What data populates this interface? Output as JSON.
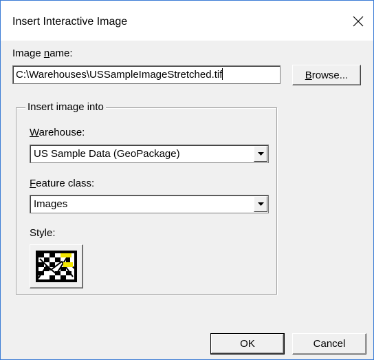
{
  "dialog": {
    "title": "Insert Interactive Image",
    "close_glyph": "✕"
  },
  "image_name": {
    "label_pre": "Image ",
    "label_accel": "n",
    "label_post": "ame:",
    "value": "C:\\Warehouses\\USSampleImageStretched.tif"
  },
  "browse_button": {
    "accel": "B",
    "rest": "rowse..."
  },
  "insert_group": {
    "legend": "Insert image into",
    "warehouse": {
      "label_accel": "W",
      "label_rest": "arehouse:",
      "selected": "US Sample Data (GeoPackage)"
    },
    "feature_class": {
      "label_accel": "F",
      "label_rest": "eature class:",
      "selected": "Images"
    },
    "style": {
      "label": "Style:",
      "icon": "image-style-icon",
      "colors": {
        "black": "#000000",
        "white": "#ffffff",
        "yellow": "#f2e600"
      }
    }
  },
  "footer": {
    "ok_label": "OK",
    "cancel_label": "Cancel"
  },
  "colors": {
    "window_border": "#3a7bd5",
    "dialog_bg": "#f0f0f0"
  }
}
